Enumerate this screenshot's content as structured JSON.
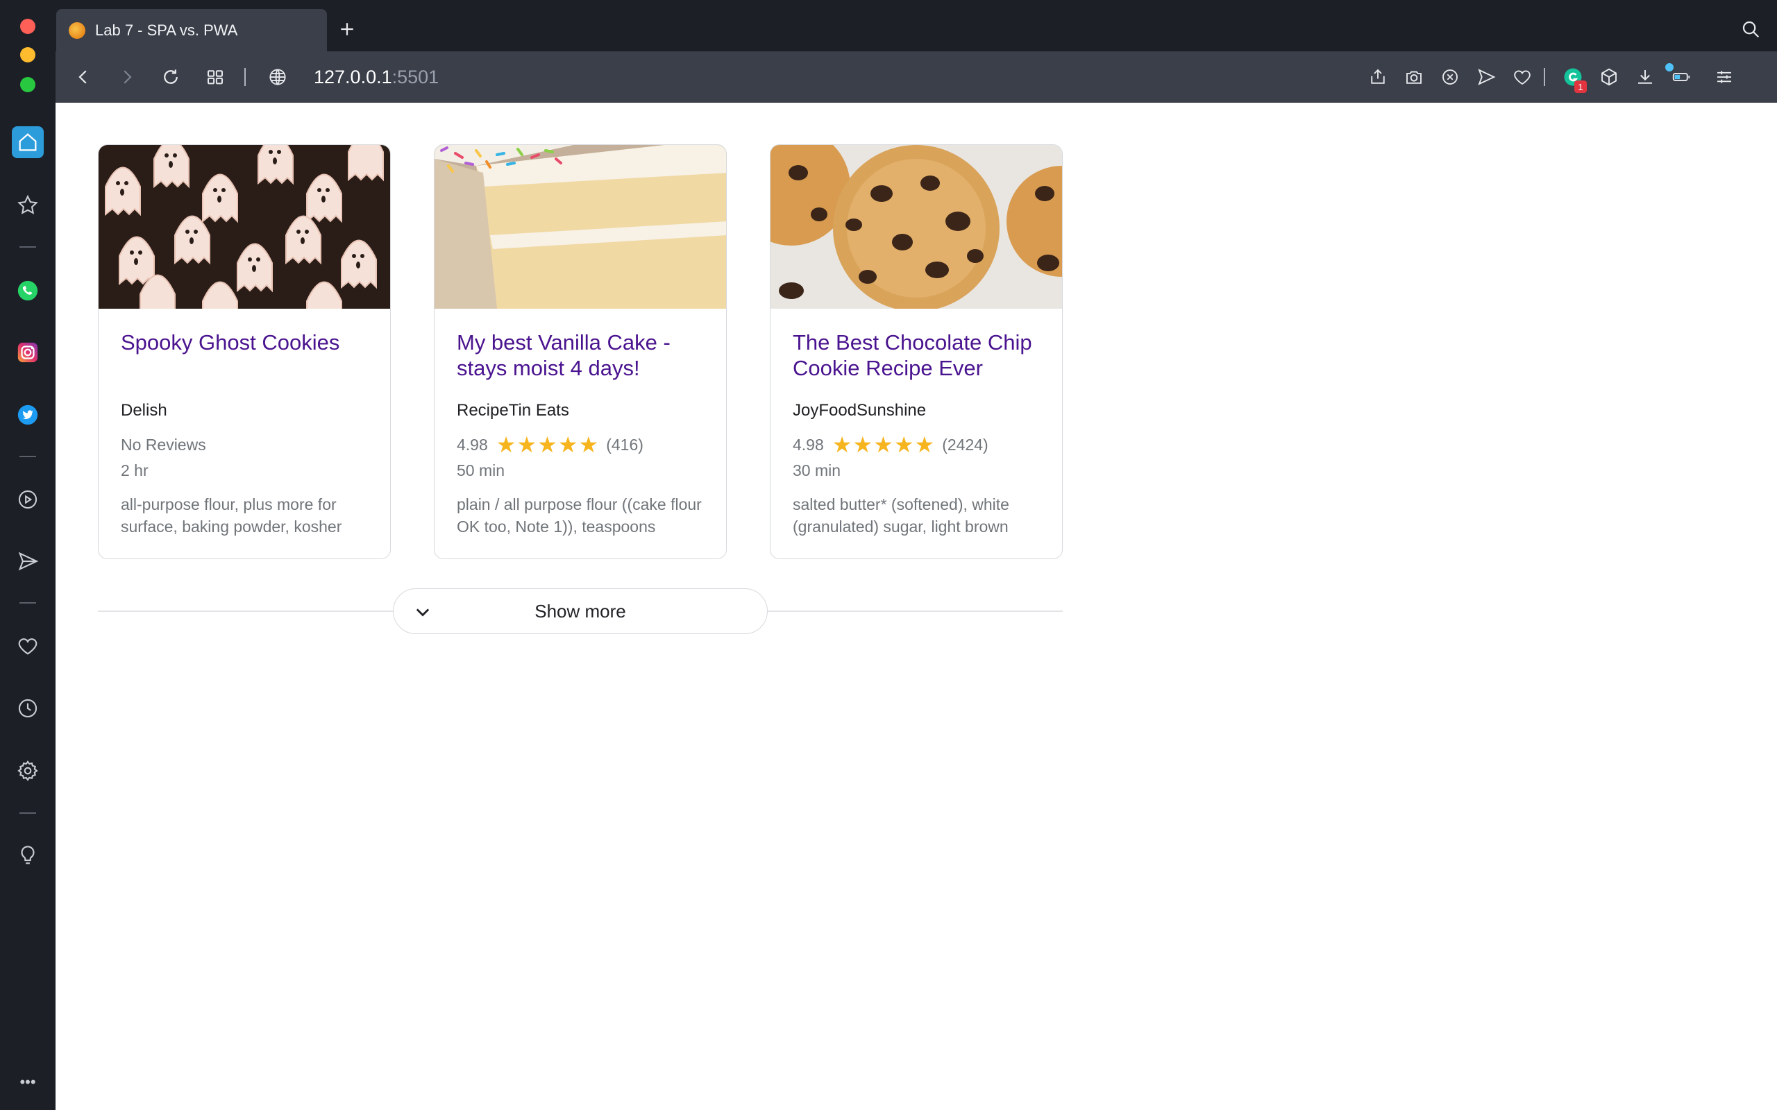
{
  "browser": {
    "tab_title": "Lab 7 - SPA vs. PWA",
    "url_host": "127.0.0.1",
    "url_port": ":5501",
    "extension_badge": "1"
  },
  "sidebar": {
    "items": [
      "home-icon",
      "star-icon",
      "whatsapp-icon",
      "instagram-icon",
      "twitter-icon",
      "player-icon",
      "send-icon",
      "heart-icon",
      "history-icon",
      "settings-icon",
      "lightbulb-icon",
      "more-icon"
    ],
    "more_label": "•••"
  },
  "recipes": [
    {
      "title": "Spooky Ghost Cookies",
      "source": "Delish",
      "rating_text": "No Reviews",
      "rating_value": "",
      "stars": "",
      "reviews": "",
      "time": "2 hr",
      "ingredients": "all-purpose flour, plus more for surface, baking powder, kosher"
    },
    {
      "title": "My best Vanilla Cake - stays moist 4 days!",
      "source": "RecipeTin Eats",
      "rating_text": "",
      "rating_value": "4.98",
      "stars": "★★★★★",
      "reviews": "(416)",
      "time": "50 min",
      "ingredients": "plain / all purpose flour ((cake flour OK too, Note 1)), teaspoons"
    },
    {
      "title": "The Best Chocolate Chip Cookie Recipe Ever",
      "source": "JoyFoodSunshine",
      "rating_text": "",
      "rating_value": "4.98",
      "stars": "★★★★★",
      "reviews": "(2424)",
      "time": "30 min",
      "ingredients": "salted butter* (softened), white (granulated) sugar, light brown"
    }
  ],
  "show_more_label": "Show more",
  "colors": {
    "title_link": "#4a138f",
    "star": "#f6b51e",
    "chrome_dark": "#1c1f26",
    "toolbar": "#3a3f4a"
  }
}
